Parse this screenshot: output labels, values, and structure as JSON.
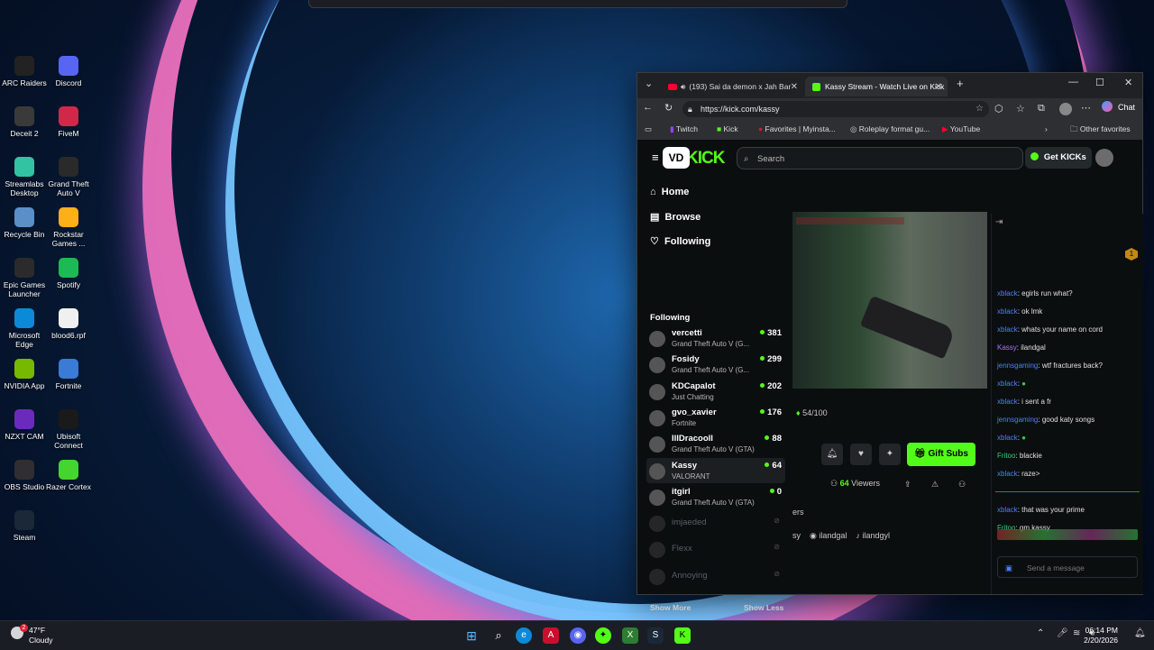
{
  "desktop_icons": [
    {
      "label": "ARC Raiders",
      "color": "#222222"
    },
    {
      "label": "Discord",
      "color": "#5865f2"
    },
    {
      "label": "Deceit 2",
      "color": "#3a3a3a"
    },
    {
      "label": "FiveM",
      "color": "#d1284a"
    },
    {
      "label": "Streamlabs Desktop",
      "color": "#31c3a2"
    },
    {
      "label": "Grand Theft Auto V",
      "color": "#2a2a2a"
    },
    {
      "label": "Recycle Bin",
      "color": "#5a8fc8"
    },
    {
      "label": "Rockstar Games ...",
      "color": "#fcaf17"
    },
    {
      "label": "Epic Games Launcher",
      "color": "#2b2b2b"
    },
    {
      "label": "Spotify",
      "color": "#1db954"
    },
    {
      "label": "Microsoft Edge",
      "color": "#0c8ad8"
    },
    {
      "label": "blood6.rpf",
      "color": "#f0f0f0"
    },
    {
      "label": "NVIDIA App",
      "color": "#76b900"
    },
    {
      "label": "Fortnite",
      "color": "#3a7bd5"
    },
    {
      "label": "NZXT CAM",
      "color": "#6a2bbd"
    },
    {
      "label": "Ubisoft Connect",
      "color": "#1a1a1a"
    },
    {
      "label": "OBS Studio",
      "color": "#302e31"
    },
    {
      "label": "Razer Cortex",
      "color": "#44d62c"
    },
    {
      "label": "Steam",
      "color": "#1b2838"
    }
  ],
  "browser": {
    "tabs": [
      {
        "title": "(193) Sai da demon x Jah Bar",
        "active": false
      },
      {
        "title": "Kassy Stream - Watch Live on Kick",
        "active": true
      }
    ],
    "new_tab": "+",
    "url": "https://kick.com/kassy",
    "chat_label": "Chat",
    "bookmarks": [
      "Twitch",
      "Kick",
      "Favorites | Myinsta...",
      "Roleplay format gu...",
      "YouTube"
    ],
    "other_favorites": "Other favorites"
  },
  "kick": {
    "logo": "KICK",
    "logo_badge": "VD",
    "search_placeholder": "Search",
    "get_kicks": "Get KICKs",
    "nav": [
      "Home",
      "Browse",
      "Following"
    ],
    "following_heading": "Following",
    "channels": [
      {
        "name": "vercetti",
        "game": "Grand Theft Auto V (G...",
        "viewers": "381",
        "live": true
      },
      {
        "name": "Fosidy",
        "game": "Grand Theft Auto V (G...",
        "viewers": "299",
        "live": true
      },
      {
        "name": "KDCapalot",
        "game": "Just Chatting",
        "viewers": "202",
        "live": true
      },
      {
        "name": "gvo_xavier",
        "game": "Fortnite",
        "viewers": "176",
        "live": true
      },
      {
        "name": "IllDracooll",
        "game": "Grand Theft Auto V (GTA)",
        "viewers": "88",
        "live": true
      },
      {
        "name": "Kassy",
        "game": "VALORANT",
        "viewers": "64",
        "live": true
      },
      {
        "name": "itgirl",
        "game": "Grand Theft Auto V (GTA)",
        "viewers": "0",
        "live": true
      },
      {
        "name": "imjaeded",
        "game": "",
        "viewers": "",
        "live": false
      },
      {
        "name": "Flexx",
        "game": "",
        "viewers": "",
        "live": false
      },
      {
        "name": "Annoying",
        "game": "",
        "viewers": "",
        "live": false
      }
    ],
    "show_more": "Show More",
    "show_less": "Show Less",
    "progress": "54/100",
    "gift_subs": "Gift Subs",
    "viewers_count": "64",
    "viewers_label": "Viewers",
    "partial_text": "ers",
    "socials": [
      "sy",
      "ilandgal",
      "ilandgyl"
    ],
    "chat_messages": [
      {
        "user": "xblack",
        "text": "egirls run what?"
      },
      {
        "user": "xblack",
        "text": "ok lmk"
      },
      {
        "user": "xblack",
        "text": "whats your name on cord"
      },
      {
        "user": "Kassy",
        "text": "ilandgal"
      },
      {
        "user": "jennsgaming",
        "text": "wtf fractures back?"
      },
      {
        "user": "xblack",
        "text": ""
      },
      {
        "user": "xblack",
        "text": "i sent a fr"
      },
      {
        "user": "jennsgaming",
        "text": "good katy songs"
      },
      {
        "user": "xblack",
        "text": ""
      },
      {
        "user": "Fritoo",
        "text": "blackie"
      },
      {
        "user": "xblack",
        "text": "raze>"
      },
      {
        "user": "xblack",
        "text": "that was your prime"
      },
      {
        "user": "Fritoo",
        "text": "gm kassy"
      }
    ],
    "chat_placeholder": "Send a message",
    "badge_number": "1"
  },
  "taskbar": {
    "weather_temp": "47°F",
    "weather_desc": "Cloudy",
    "weather_alert": "2",
    "time": "06:14 PM",
    "date": "2/20/2026"
  }
}
